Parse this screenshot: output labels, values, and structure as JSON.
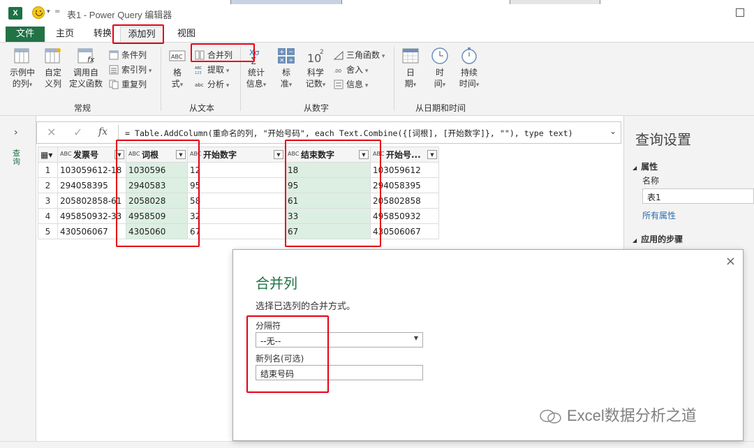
{
  "titlebar": {
    "title": "表1 - Power Query 编辑器",
    "qat_separator": "="
  },
  "tabs": [
    "文件",
    "主页",
    "转换",
    "添加列",
    "视图"
  ],
  "ribbon": {
    "general": {
      "group_label": "常规",
      "example_col": [
        "示例中",
        "的列"
      ],
      "custom_col": [
        "自定",
        "义列"
      ],
      "invoke_fn": [
        "调用自",
        "定义函数"
      ],
      "conditional": "条件列",
      "index": "索引列",
      "duplicate": "重复列"
    },
    "from_text": {
      "group_label": "从文本",
      "format": [
        "格",
        "式"
      ],
      "merge": "合并列",
      "extract": "提取",
      "parse": "分析",
      "abc_icon": "ABC",
      "abc123_icon_top": "ABC",
      "abc123_icon_bottom": "123",
      "abc_small": "abc"
    },
    "from_number": {
      "group_label": "从数字",
      "stats": [
        "统计",
        "信息"
      ],
      "standard": [
        "标",
        "准"
      ],
      "scientific": [
        "科学",
        "记数"
      ],
      "trig": "三角函数",
      "round": "舍入",
      "info": "信息",
      "ten_icon": "10",
      "sup_icon": "2",
      "sigma_icon": "Σ",
      "xo_icon": "Xσ"
    },
    "from_datetime": {
      "group_label": "从日期和时间",
      "date": [
        "日",
        "期"
      ],
      "time": [
        "时",
        "间"
      ],
      "duration": [
        "持续",
        "时间"
      ]
    }
  },
  "leftpane": {
    "label": "查询"
  },
  "formula": {
    "text": "= Table.AddColumn(重命名的列, \"开始号码\", each Text.Combine({[词根], [开始数字]}, \"\"), type text)"
  },
  "table": {
    "columns": [
      "发票号",
      "词根",
      "开始数字",
      "结束数字",
      "开始号..."
    ],
    "type_icon": "ABC",
    "rows": [
      {
        "n": "1",
        "invoice": "103059612-18",
        "root": "1030596",
        "start": "12",
        "end": "18",
        "startcode": "103059612"
      },
      {
        "n": "2",
        "invoice": "294058395",
        "root": "2940583",
        "start": "95",
        "end": "95",
        "startcode": "294058395"
      },
      {
        "n": "3",
        "invoice": "205802858-61",
        "root": "2058028",
        "start": "58",
        "end": "61",
        "startcode": "205802858"
      },
      {
        "n": "4",
        "invoice": "495850932-33",
        "root": "4958509",
        "start": "32",
        "end": "33",
        "startcode": "495850932"
      },
      {
        "n": "5",
        "invoice": "430506067",
        "root": "4305060",
        "start": "67",
        "end": "67",
        "startcode": "430506067"
      }
    ]
  },
  "rightpane": {
    "title": "查询设置",
    "properties": "属性",
    "name_label": "名称",
    "name_value": "表1",
    "all_props": "所有属性",
    "steps": "应用的步骤"
  },
  "dialog": {
    "title": "合并列",
    "description": "选择已选列的合并方式。",
    "separator_label": "分隔符",
    "separator_value": "--无--",
    "newcol_label": "新列名(可选)",
    "newcol_value": "结束号码",
    "close": "×"
  },
  "watermark": "Excel数据分析之道",
  "colors": {
    "excel_green": "#217346",
    "highlight_red": "#e60012",
    "selected_cell": "#dcefe2"
  }
}
